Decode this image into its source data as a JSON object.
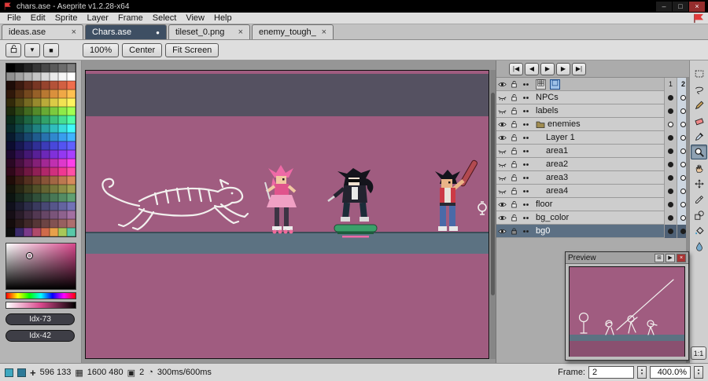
{
  "window": {
    "title": "chars.ase - Aseprite v1.2.28-x64",
    "minimize": "–",
    "maximize": "□",
    "close": "×"
  },
  "menu": {
    "items": [
      "File",
      "Edit",
      "Sprite",
      "Layer",
      "Frame",
      "Select",
      "View",
      "Help"
    ]
  },
  "tabs": [
    {
      "label": "ideas.ase",
      "close": "×",
      "active": false
    },
    {
      "label": "Chars.ase",
      "modified": "●",
      "active": true
    },
    {
      "label": "tileset_0.png",
      "close": "×",
      "active": false
    },
    {
      "label": "enemy_tough_",
      "close": "×",
      "active": false
    }
  ],
  "context_bar": {
    "dropdown_glyph": "▼",
    "swatch_glyph": "■",
    "buttons": [
      "100%",
      "Center",
      "Fit Screen"
    ]
  },
  "palette": {
    "colors": [
      "#000000",
      "#121212",
      "#242424",
      "#363636",
      "#484848",
      "#5a5a5a",
      "#6c6c6c",
      "#7e7e7e",
      "#909090",
      "#a2a2a2",
      "#b4b4b4",
      "#c6c6c6",
      "#d8d8d8",
      "#eaeaea",
      "#f6f6f6",
      "#ffffff",
      "#1e0c08",
      "#3c1a10",
      "#5a281a",
      "#783624",
      "#96442e",
      "#b45238",
      "#d26042",
      "#f06e4c",
      "#30180a",
      "#523014",
      "#74481e",
      "#966028",
      "#b87832",
      "#da903c",
      "#f0a846",
      "#ffc050",
      "#322a0a",
      "#544a16",
      "#766a22",
      "#988a2e",
      "#baaa3a",
      "#dcca46",
      "#f2e252",
      "#fff45e",
      "#1c2a0c",
      "#2f4a16",
      "#426a20",
      "#558a2a",
      "#68aa34",
      "#7bca3e",
      "#8eea48",
      "#a1ff52",
      "#0a2a1a",
      "#14482e",
      "#1e6642",
      "#288456",
      "#32a26a",
      "#3cc07e",
      "#46de92",
      "#50fca6",
      "#082828",
      "#104646",
      "#186464",
      "#208282",
      "#28a0a0",
      "#30bebe",
      "#38dcdc",
      "#40fafa",
      "#081a2e",
      "#10304e",
      "#18466e",
      "#205c8e",
      "#2872ae",
      "#3088ce",
      "#389eee",
      "#40b4ff",
      "#0c0c30",
      "#181852",
      "#242474",
      "#303096",
      "#3c3cb8",
      "#4848da",
      "#5454f2",
      "#6060ff",
      "#1c0830",
      "#301052",
      "#441874",
      "#582096",
      "#6c28b8",
      "#8030da",
      "#9438f2",
      "#a840ff",
      "#2a0824",
      "#481040",
      "#66185c",
      "#842078",
      "#a22894",
      "#c030b0",
      "#de38cc",
      "#fc40e8",
      "#30081a",
      "#50102e",
      "#701842",
      "#902056",
      "#b0286a",
      "#d0307e",
      "#f03892",
      "#ff50a6",
      "#200c08",
      "#3a1e14",
      "#543020",
      "#6e422c",
      "#885438",
      "#a26644",
      "#bc7850",
      "#d68a5c",
      "#14140a",
      "#282814",
      "#3c3c1e",
      "#505028",
      "#646432",
      "#78783c",
      "#8c8c46",
      "#a0a050",
      "#0c1410",
      "#18281e",
      "#243c2c",
      "#30503a",
      "#3c6448",
      "#487856",
      "#548c64",
      "#60a072",
      "#10101c",
      "#1e1e32",
      "#2c2c48",
      "#3a3a5e",
      "#484874",
      "#56568a",
      "#6464a0",
      "#7272b6",
      "#160e16",
      "#2a1c2a",
      "#3e2a3e",
      "#523852",
      "#664666",
      "#7a547a",
      "#8e628e",
      "#a270a2",
      "#140c0c",
      "#2a1a1a",
      "#402828",
      "#563636",
      "#6c4444",
      "#825252",
      "#986060",
      "#ae6e6e",
      "#0e0e0e",
      "#3a2a6a",
      "#7a3a8a",
      "#b04a6a",
      "#d06a4a",
      "#e8a04a",
      "#a8c858",
      "#58c8a8"
    ]
  },
  "color_selector": {
    "fg_label": "Idx-73",
    "bg_label": "Idx-42"
  },
  "timeline": {
    "nav": [
      "|◀",
      "◀",
      "▶",
      "▶",
      "▶|"
    ],
    "frames": [
      "1",
      "2"
    ],
    "current_frame": "2",
    "layers": [
      {
        "name": "NPCs",
        "eye": "closed",
        "indent": 0,
        "group": false,
        "selected": false,
        "locked": false,
        "cels": [
          "filled",
          "empty"
        ]
      },
      {
        "name": "labels",
        "eye": "closed",
        "indent": 0,
        "group": false,
        "selected": false,
        "locked": false,
        "cels": [
          "filled",
          "empty"
        ]
      },
      {
        "name": "enemies",
        "eye": "open",
        "indent": 0,
        "group": true,
        "selected": false,
        "locked": false,
        "cels": [
          "empty",
          "empty"
        ]
      },
      {
        "name": "Layer 1",
        "eye": "open",
        "indent": 1,
        "group": false,
        "selected": false,
        "locked": false,
        "cels": [
          "filled",
          "empty"
        ]
      },
      {
        "name": "area1",
        "eye": "closed",
        "indent": 1,
        "group": false,
        "selected": false,
        "locked": false,
        "cels": [
          "filled",
          "empty"
        ]
      },
      {
        "name": "area2",
        "eye": "closed",
        "indent": 1,
        "group": false,
        "selected": false,
        "locked": false,
        "cels": [
          "filled",
          "empty"
        ]
      },
      {
        "name": "area3",
        "eye": "closed",
        "indent": 1,
        "group": false,
        "selected": false,
        "locked": false,
        "cels": [
          "filled",
          "empty"
        ]
      },
      {
        "name": "area4",
        "eye": "closed",
        "indent": 1,
        "group": false,
        "selected": false,
        "locked": false,
        "cels": [
          "filled",
          "empty"
        ]
      },
      {
        "name": "floor",
        "eye": "open",
        "indent": 0,
        "group": false,
        "selected": false,
        "locked": false,
        "cels": [
          "filled",
          "empty"
        ]
      },
      {
        "name": "bg_color",
        "eye": "open",
        "indent": 0,
        "group": false,
        "selected": false,
        "locked": false,
        "cels": [
          "filled",
          "empty"
        ]
      },
      {
        "name": "bg0",
        "eye": "open",
        "indent": 0,
        "group": false,
        "selected": true,
        "locked": true,
        "cels": [
          "filled",
          "filled"
        ]
      }
    ]
  },
  "tools": [
    {
      "name": "rectangular-marquee-tool",
      "icon": "marquee",
      "active": false
    },
    {
      "name": "lasso-tool",
      "icon": "lasso",
      "active": false
    },
    {
      "name": "pencil-tool",
      "icon": "pencil",
      "active": false
    },
    {
      "name": "eraser-tool",
      "icon": "eraser",
      "active": false
    },
    {
      "name": "eyedropper-tool",
      "icon": "eyedropper",
      "active": false
    },
    {
      "name": "zoom-tool",
      "icon": "zoom",
      "active": true
    },
    {
      "name": "hand-tool",
      "icon": "hand",
      "active": false
    },
    {
      "name": "move-tool",
      "icon": "move",
      "active": false
    },
    {
      "name": "slice-tool",
      "icon": "slice",
      "active": false
    },
    {
      "name": "shapes-tool",
      "icon": "shapes",
      "active": false
    },
    {
      "name": "paint-bucket-tool",
      "icon": "bucket",
      "active": false
    },
    {
      "name": "blur-tool",
      "icon": "blur",
      "active": false
    }
  ],
  "preview": {
    "title": "Preview",
    "buttons": [
      "⊞",
      "▶",
      "×"
    ],
    "zoom_button": "1:1"
  },
  "status_bar": {
    "crosshair": "+",
    "position": "596 133",
    "size_icon": "▦",
    "sprite_size": "1600 480",
    "frames_icon": "▣",
    "frame_count": "2",
    "clock_icon": "◔",
    "frame_duration": "300ms/600ms",
    "frame_label": "Frame:",
    "frame_value": "2",
    "zoom_value": "400.0%"
  },
  "colors": {
    "canvas_bg": "#a05c80",
    "canvas_dark_band": "#555161",
    "canvas_floor": "#5c7282",
    "active_tab": "#3e4f63",
    "selected_row": "#5c7084"
  }
}
